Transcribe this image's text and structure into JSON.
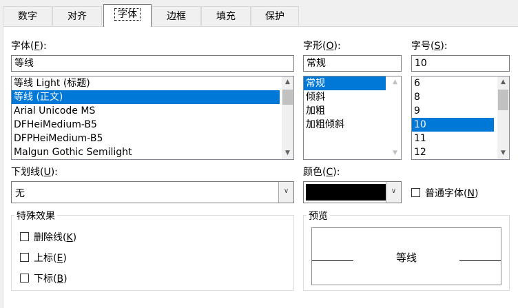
{
  "tabs": [
    {
      "label": "数字"
    },
    {
      "label": "对齐"
    },
    {
      "label": "字体"
    },
    {
      "label": "边框"
    },
    {
      "label": "填充"
    },
    {
      "label": "保护"
    }
  ],
  "font": {
    "label": "字体(",
    "key": "F",
    "label_end": "):",
    "value": "等线",
    "items": [
      "等线 Light (标题)",
      "等线 (正文)",
      "Arial Unicode MS",
      "DFHeiMedium-B5",
      "DFPHeiMedium-B5",
      "Malgun Gothic Semilight"
    ],
    "selected_index": 1
  },
  "style": {
    "label": "字形(",
    "key": "O",
    "label_end": "):",
    "value": "常规",
    "items": [
      "常规",
      "倾斜",
      "加粗",
      "加粗倾斜"
    ],
    "selected_index": 0
  },
  "size": {
    "label": "字号(",
    "key": "S",
    "label_end": "):",
    "value": "10",
    "items": [
      "6",
      "8",
      "9",
      "10",
      "11",
      "12"
    ],
    "selected_index": 3
  },
  "underline": {
    "label": "下划线(",
    "key": "U",
    "label_end": "):",
    "value": "无"
  },
  "color": {
    "label": "颜色(",
    "key": "C",
    "label_end": "):",
    "swatch": "#000000"
  },
  "normal_font": {
    "label": "普通字体(",
    "key": "N",
    "label_end": ")",
    "checked": false
  },
  "effects": {
    "title": "特殊效果",
    "strikethrough": {
      "label": "删除线(",
      "key": "K",
      "label_end": ")"
    },
    "superscript": {
      "label": "上标(",
      "key": "E",
      "label_end": ")"
    },
    "subscript": {
      "label": "下标(",
      "key": "B",
      "label_end": ")"
    }
  },
  "preview": {
    "title": "预览",
    "text": "等线"
  },
  "colors": {
    "selection": "#0078d7",
    "border": "#7a7a7a"
  }
}
